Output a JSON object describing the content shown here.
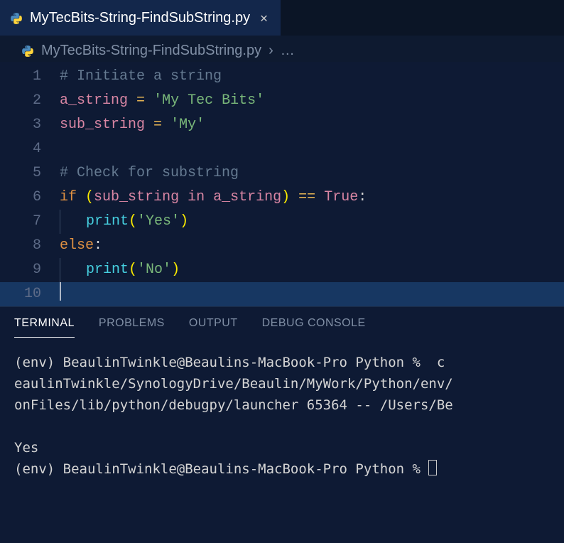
{
  "tab": {
    "filename": "MyTecBits-String-FindSubString.py",
    "language_icon": "python-icon"
  },
  "breadcrumb": {
    "filename": "MyTecBits-String-FindSubString.py",
    "chevron": "›",
    "rest": "…"
  },
  "editor": {
    "lines": [
      {
        "n": "1",
        "highlight": false,
        "indent": 0,
        "tokens": [
          {
            "cls": "c-comment",
            "t": "# Initiate a string"
          }
        ]
      },
      {
        "n": "2",
        "highlight": false,
        "indent": 0,
        "tokens": [
          {
            "cls": "c-var",
            "t": "a_string"
          },
          {
            "cls": "c-default",
            "t": " "
          },
          {
            "cls": "c-op",
            "t": "="
          },
          {
            "cls": "c-default",
            "t": " "
          },
          {
            "cls": "c-string",
            "t": "'My Tec Bits'"
          }
        ]
      },
      {
        "n": "3",
        "highlight": false,
        "indent": 0,
        "tokens": [
          {
            "cls": "c-var",
            "t": "sub_string"
          },
          {
            "cls": "c-default",
            "t": " "
          },
          {
            "cls": "c-op",
            "t": "="
          },
          {
            "cls": "c-default",
            "t": " "
          },
          {
            "cls": "c-string",
            "t": "'My'"
          }
        ]
      },
      {
        "n": "4",
        "highlight": false,
        "indent": 0,
        "tokens": []
      },
      {
        "n": "5",
        "highlight": false,
        "indent": 0,
        "tokens": [
          {
            "cls": "c-comment",
            "t": "# Check for substring"
          }
        ]
      },
      {
        "n": "6",
        "highlight": false,
        "indent": 0,
        "tokens": [
          {
            "cls": "c-ctrl",
            "t": "if"
          },
          {
            "cls": "c-default",
            "t": " "
          },
          {
            "cls": "c-paren",
            "t": "("
          },
          {
            "cls": "c-var",
            "t": "sub_string"
          },
          {
            "cls": "c-default",
            "t": " "
          },
          {
            "cls": "c-keyword",
            "t": "in"
          },
          {
            "cls": "c-default",
            "t": " "
          },
          {
            "cls": "c-var",
            "t": "a_string"
          },
          {
            "cls": "c-paren",
            "t": ")"
          },
          {
            "cls": "c-default",
            "t": " "
          },
          {
            "cls": "c-op",
            "t": "=="
          },
          {
            "cls": "c-default",
            "t": " "
          },
          {
            "cls": "c-const",
            "t": "True"
          },
          {
            "cls": "c-default",
            "t": ":"
          }
        ]
      },
      {
        "n": "7",
        "highlight": false,
        "indent": 1,
        "tokens": [
          {
            "cls": "c-func",
            "t": "print"
          },
          {
            "cls": "c-paren",
            "t": "("
          },
          {
            "cls": "c-string",
            "t": "'Yes'"
          },
          {
            "cls": "c-paren",
            "t": ")"
          }
        ]
      },
      {
        "n": "8",
        "highlight": false,
        "indent": 0,
        "tokens": [
          {
            "cls": "c-ctrl",
            "t": "else"
          },
          {
            "cls": "c-default",
            "t": ":"
          }
        ]
      },
      {
        "n": "9",
        "highlight": false,
        "indent": 1,
        "tokens": [
          {
            "cls": "c-func",
            "t": "print"
          },
          {
            "cls": "c-paren",
            "t": "("
          },
          {
            "cls": "c-string",
            "t": "'No'"
          },
          {
            "cls": "c-paren",
            "t": ")"
          }
        ]
      },
      {
        "n": "10",
        "highlight": true,
        "indent": 0,
        "cursor": true,
        "tokens": []
      }
    ]
  },
  "panel": {
    "tabs": [
      {
        "id": "terminal",
        "label": "TERMINAL",
        "active": true
      },
      {
        "id": "problems",
        "label": "PROBLEMS",
        "active": false
      },
      {
        "id": "output",
        "label": "OUTPUT",
        "active": false
      },
      {
        "id": "debug",
        "label": "DEBUG CONSOLE",
        "active": false
      }
    ]
  },
  "terminal": {
    "lines": [
      "(env) BeaulinTwinkle@Beaulins-MacBook-Pro Python %  c",
      "eaulinTwinkle/SynologyDrive/Beaulin/MyWork/Python/env/",
      "onFiles/lib/python/debugpy/launcher 65364 -- /Users/Be",
      "",
      "Yes"
    ],
    "prompt": "(env) BeaulinTwinkle@Beaulins-MacBook-Pro Python % "
  }
}
